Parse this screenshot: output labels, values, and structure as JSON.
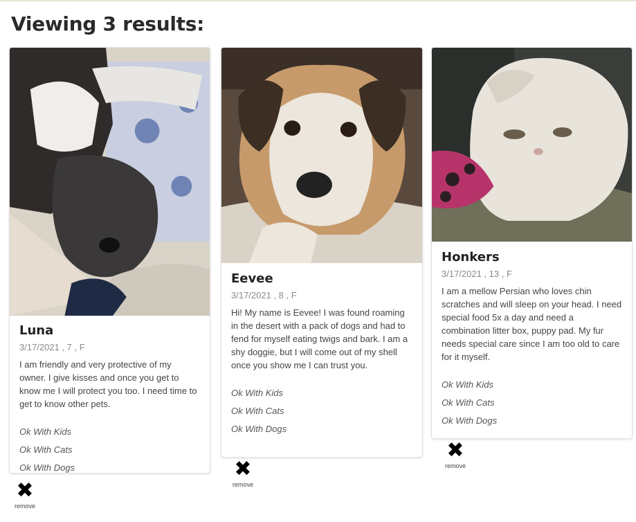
{
  "heading": "Viewing 3 results:",
  "pets": [
    {
      "name": "Luna",
      "meta": "3/17/2021 , 7 , F",
      "description": "I am friendly and very protective of my owner. I give kisses and once you get to know me I will protect you too. I need time to get to know other pets.",
      "traits": [
        "Ok With Kids",
        "Ok With Cats",
        "Ok With Dogs"
      ],
      "remove_label": "remove"
    },
    {
      "name": "Eevee",
      "meta": "3/17/2021 , 8 , F",
      "description": "Hi! My name is Eevee! I was found roaming in the desert with a pack of dogs and had to fend for myself eating twigs and bark. I am a shy doggie, but I will come out of my shell once you show me I can trust you.",
      "traits": [
        "Ok With Kids",
        "Ok With Cats",
        "Ok With Dogs"
      ],
      "remove_label": "remove"
    },
    {
      "name": "Honkers",
      "meta": "3/17/2021 , 13 , F",
      "description": "I am a mellow Persian who loves chin scratches and will sleep on your head. I need special food 5x a day and need a combination litter box, puppy pad. My fur needs special care since I am too old to care for it myself.",
      "traits": [
        "Ok With Kids",
        "Ok With Cats",
        "Ok With Dogs"
      ],
      "remove_label": "remove"
    }
  ],
  "remove_icon": "close-x-icon",
  "colors": {
    "heading": "#2a2a2a",
    "meta": "#8a8a8a",
    "border": "#e2e2e2"
  }
}
